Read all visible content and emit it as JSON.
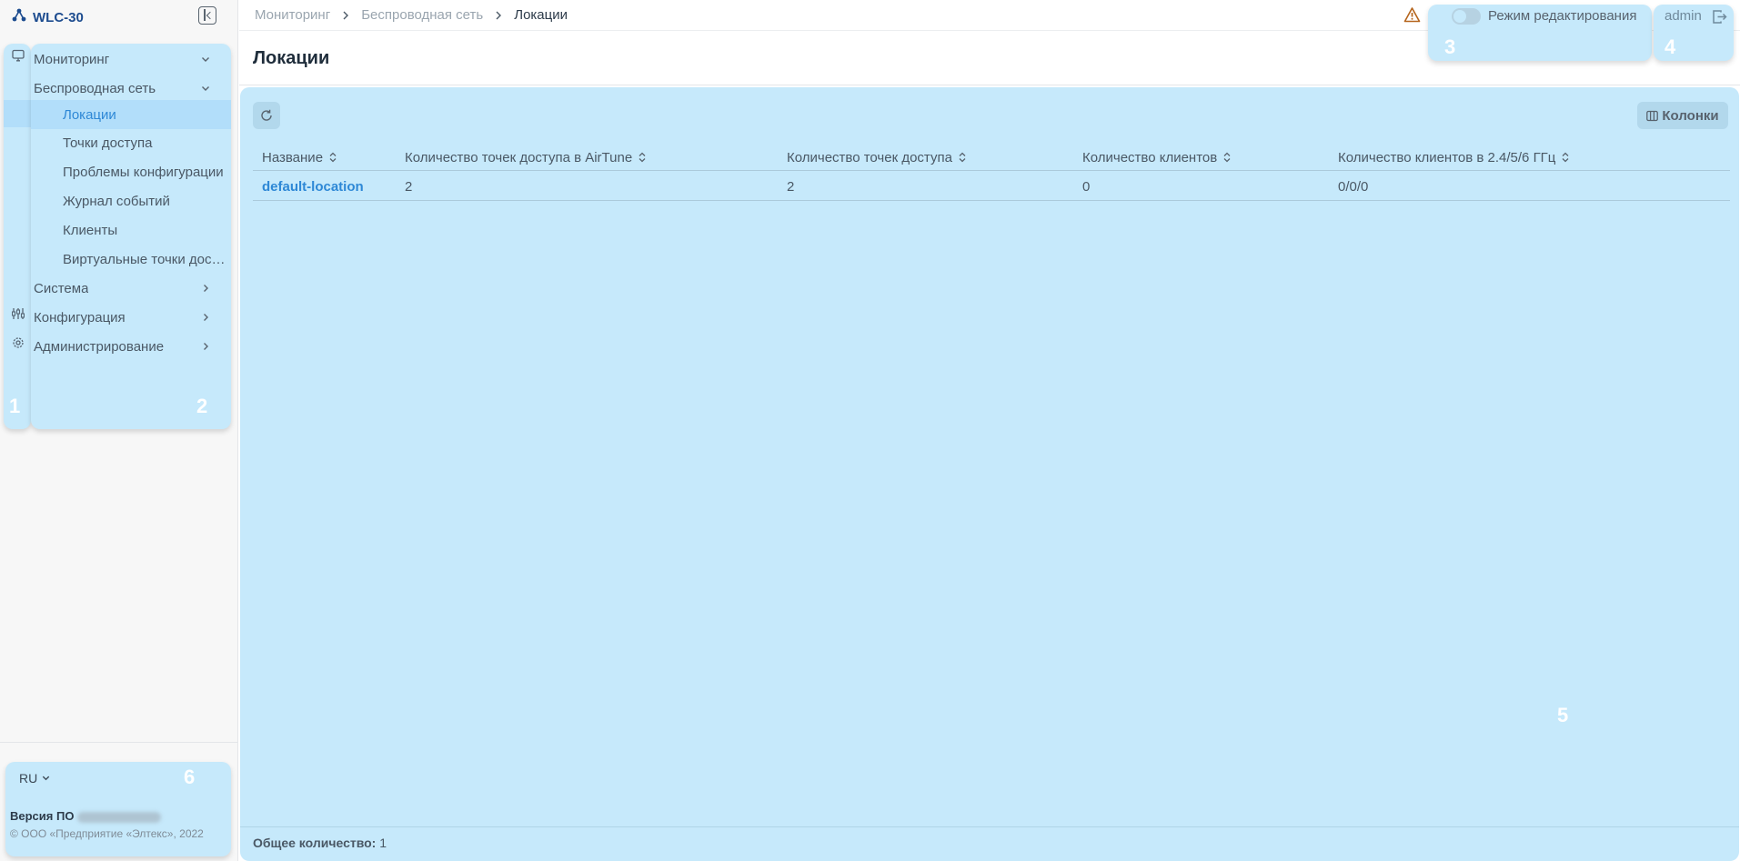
{
  "app": {
    "title": "WLC-30"
  },
  "sidebar": {
    "items": [
      {
        "label": "Мониторинг",
        "expanded": true
      },
      {
        "label": "Беспроводная сеть",
        "expanded": true
      },
      {
        "label": "Локации",
        "active": true
      },
      {
        "label": "Точки доступа"
      },
      {
        "label": "Проблемы конфигурации"
      },
      {
        "label": "Журнал событий"
      },
      {
        "label": "Клиенты"
      },
      {
        "label": "Виртуальные точки доступа"
      },
      {
        "label": "Система",
        "expanded": false
      },
      {
        "label": "Конфигурация",
        "expanded": false
      },
      {
        "label": "Администрирование",
        "expanded": false
      }
    ],
    "region_labels": {
      "icons": "1",
      "nav": "2",
      "footer": "6"
    },
    "footer": {
      "language": "RU",
      "version_label": "Версия ПО",
      "copyright": "© ООО «Предприятие «Элтекс», 2022"
    }
  },
  "topbar": {
    "breadcrumb": [
      "Мониторинг",
      "Беспроводная сеть",
      "Локации"
    ],
    "edit_mode_label": "Режим редактирования",
    "edit_mode_on": false,
    "username": "admin",
    "region_labels": {
      "edit": "3",
      "user": "4"
    }
  },
  "page": {
    "title": "Локации",
    "columns_button": "Колонки",
    "region_label": "5",
    "table": {
      "columns": [
        "Название",
        "Количество точек доступа в AirTune",
        "Количество точек доступа",
        "Количество клиентов",
        "Количество клиентов в 2.4/5/6 ГГц"
      ],
      "rows": [
        [
          "default-location",
          "2",
          "2",
          "0",
          "0/0/0"
        ]
      ]
    },
    "total_label": "Общее количество:",
    "total_value": "1"
  },
  "colors": {
    "highlight": "#c6e9fb",
    "accent": "#2e88d6",
    "warning": "#b5651d",
    "logo": "#1d4c8f"
  }
}
